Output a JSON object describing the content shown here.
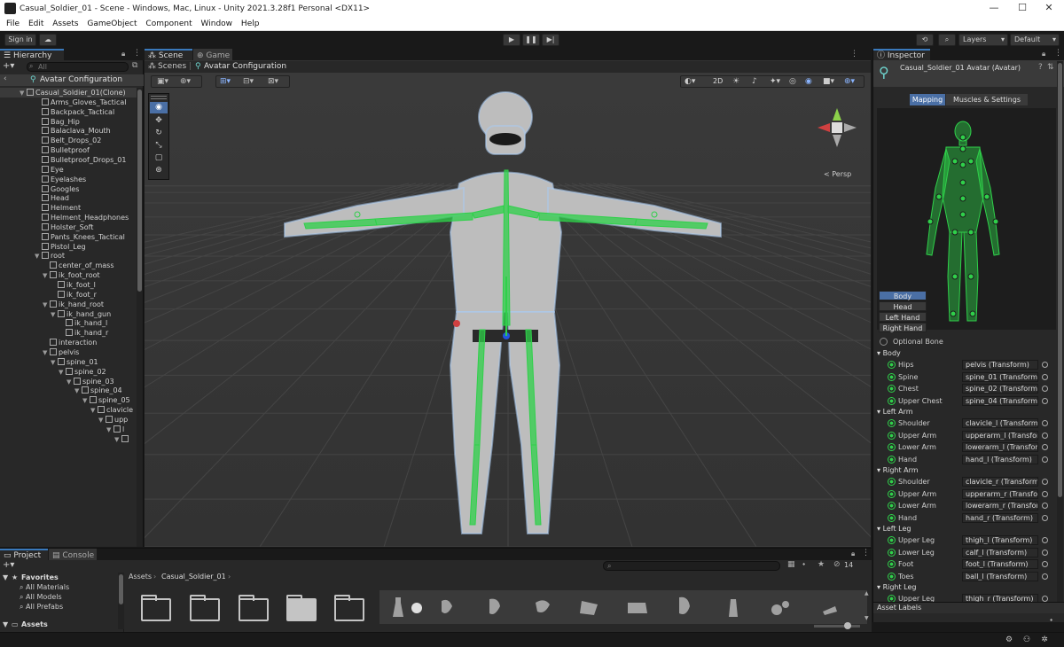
{
  "window": {
    "title": "Casual_Soldier_01 - Scene - Windows, Mac, Linux - Unity 2021.3.28f1 Personal <DX11>",
    "controls": [
      "—",
      "☐",
      "✕"
    ]
  },
  "menubar": [
    "File",
    "Edit",
    "Assets",
    "GameObject",
    "Component",
    "Window",
    "Help"
  ],
  "toolbar": {
    "sign_in": "Sign in",
    "layers": "Layers",
    "layout": "Default",
    "play": "▶",
    "pause": "❚❚",
    "step": "▶|"
  },
  "hierarchy": {
    "tab": "Hierarchy",
    "search_placeholder": "All",
    "context_title": "Avatar Configuration",
    "items": [
      {
        "label": "Casual_Soldier_01(Clone)",
        "indent": 0,
        "arrow": "▼",
        "selected": true
      },
      {
        "label": "Arms_Gloves_Tactical",
        "indent": 1,
        "arrow": ""
      },
      {
        "label": "Backpack_Tactical",
        "indent": 1,
        "arrow": ""
      },
      {
        "label": "Bag_Hip",
        "indent": 1,
        "arrow": ""
      },
      {
        "label": "Balaclava_Mouth",
        "indent": 1,
        "arrow": ""
      },
      {
        "label": "Belt_Drops_02",
        "indent": 1,
        "arrow": ""
      },
      {
        "label": "Bulletproof",
        "indent": 1,
        "arrow": ""
      },
      {
        "label": "Bulletproof_Drops_01",
        "indent": 1,
        "arrow": ""
      },
      {
        "label": "Eye",
        "indent": 1,
        "arrow": ""
      },
      {
        "label": "Eyelashes",
        "indent": 1,
        "arrow": ""
      },
      {
        "label": "Googles",
        "indent": 1,
        "arrow": ""
      },
      {
        "label": "Head",
        "indent": 1,
        "arrow": ""
      },
      {
        "label": "Helment",
        "indent": 1,
        "arrow": ""
      },
      {
        "label": "Helment_Headphones",
        "indent": 1,
        "arrow": ""
      },
      {
        "label": "Holster_Soft",
        "indent": 1,
        "arrow": ""
      },
      {
        "label": "Pants_Knees_Tactical",
        "indent": 1,
        "arrow": ""
      },
      {
        "label": "Pistol_Leg",
        "indent": 1,
        "arrow": ""
      },
      {
        "label": "root",
        "indent": 1,
        "arrow": "▼"
      },
      {
        "label": "center_of_mass",
        "indent": 2,
        "arrow": ""
      },
      {
        "label": "ik_foot_root",
        "indent": 2,
        "arrow": "▼"
      },
      {
        "label": "ik_foot_l",
        "indent": 3,
        "arrow": ""
      },
      {
        "label": "ik_foot_r",
        "indent": 3,
        "arrow": ""
      },
      {
        "label": "ik_hand_root",
        "indent": 2,
        "arrow": "▼"
      },
      {
        "label": "ik_hand_gun",
        "indent": 3,
        "arrow": "▼"
      },
      {
        "label": "ik_hand_l",
        "indent": 4,
        "arrow": ""
      },
      {
        "label": "ik_hand_r",
        "indent": 4,
        "arrow": ""
      },
      {
        "label": "interaction",
        "indent": 2,
        "arrow": ""
      },
      {
        "label": "pelvis",
        "indent": 2,
        "arrow": "▼"
      },
      {
        "label": "spine_01",
        "indent": 3,
        "arrow": "▼"
      },
      {
        "label": "spine_02",
        "indent": 4,
        "arrow": "▼"
      },
      {
        "label": "spine_03",
        "indent": 5,
        "arrow": "▼"
      },
      {
        "label": "spine_04",
        "indent": 6,
        "arrow": "▼"
      },
      {
        "label": "spine_05",
        "indent": 7,
        "arrow": "▼"
      },
      {
        "label": "clavicle",
        "indent": 8,
        "arrow": "▼"
      },
      {
        "label": "upp",
        "indent": 9,
        "arrow": "▼"
      },
      {
        "label": "l",
        "indent": 10,
        "arrow": "▼"
      },
      {
        "label": "",
        "indent": 11,
        "arrow": "▼"
      }
    ]
  },
  "scene": {
    "tabs": [
      "Scene",
      "Game"
    ],
    "breadcrumb_root": "Scenes",
    "breadcrumb_current": "Avatar Configuration",
    "mode_2d": "2D",
    "persp_label": "< Persp"
  },
  "inspector": {
    "tab": "Inspector",
    "object_title": "Casual_Soldier_01 Avatar (Avatar)",
    "subtabs": [
      "Mapping",
      "Muscles & Settings"
    ],
    "body_part_buttons": [
      "Body",
      "Head",
      "Left Hand",
      "Right Hand"
    ],
    "optional_bone": "Optional Bone",
    "groups": [
      {
        "name": "Body",
        "bones": [
          {
            "label": "Hips",
            "value": "pelvis (Transform)"
          },
          {
            "label": "Spine",
            "value": "spine_01 (Transform"
          },
          {
            "label": "Chest",
            "value": "spine_02 (Transform"
          },
          {
            "label": "Upper Chest",
            "value": "spine_04 (Transform"
          }
        ]
      },
      {
        "name": "Left Arm",
        "bones": [
          {
            "label": "Shoulder",
            "value": "clavicle_l (Transform"
          },
          {
            "label": "Upper Arm",
            "value": "upperarm_l (Transfor"
          },
          {
            "label": "Lower Arm",
            "value": "lowerarm_l (Transfor"
          },
          {
            "label": "Hand",
            "value": "hand_l (Transform)"
          }
        ]
      },
      {
        "name": "Right Arm",
        "bones": [
          {
            "label": "Shoulder",
            "value": "clavicle_r (Transform"
          },
          {
            "label": "Upper Arm",
            "value": "upperarm_r (Transfor"
          },
          {
            "label": "Lower Arm",
            "value": "lowerarm_r (Transfor"
          },
          {
            "label": "Hand",
            "value": "hand_r (Transform)"
          }
        ]
      },
      {
        "name": "Left Leg",
        "bones": [
          {
            "label": "Upper Leg",
            "value": "thigh_l (Transform)"
          },
          {
            "label": "Lower Leg",
            "value": "calf_l (Transform)"
          },
          {
            "label": "Foot",
            "value": "foot_l (Transform)"
          },
          {
            "label": "Toes",
            "value": "ball_l (Transform)"
          }
        ]
      },
      {
        "name": "Right Leg",
        "bones": [
          {
            "label": "Upper Leg",
            "value": "thigh_r (Transform)"
          }
        ]
      }
    ],
    "asset_labels": "Asset Labels"
  },
  "project": {
    "tabs": [
      "Project",
      "Console"
    ],
    "favorites_title": "Favorites",
    "favorites": [
      "All Materials",
      "All Models",
      "All Prefabs"
    ],
    "assets_title": "Assets",
    "breadcrumb_root": "Assets",
    "breadcrumb_current": "Casual_Soldier_01",
    "hidden_count": "14"
  },
  "colors": {
    "accent": "#3a79bb",
    "bone_green": "#2fd04a",
    "panel_bg": "#282828",
    "scene_bg": "#333333"
  }
}
